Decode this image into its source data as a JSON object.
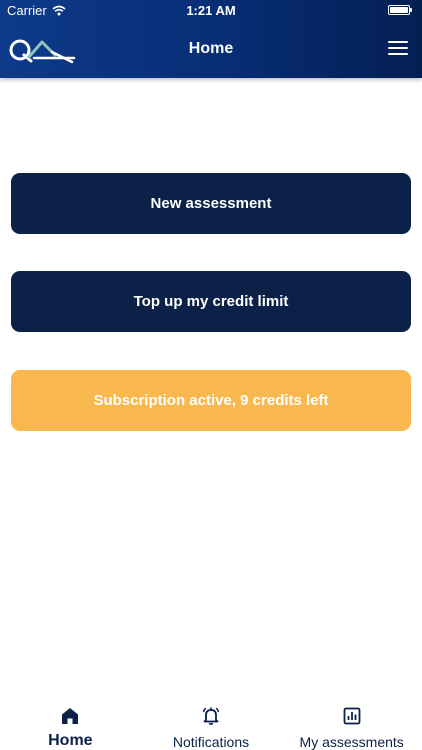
{
  "status_bar": {
    "carrier": "Carrier",
    "time": "1:21 AM"
  },
  "header": {
    "title": "Home",
    "logo": "QA-logo",
    "menu_icon": "hamburger-menu-icon"
  },
  "actions": {
    "new_assessment": "New assessment",
    "top_up": "Top up my credit limit",
    "subscription": "Subscription active, 9 credits left"
  },
  "tabs": [
    {
      "label": "Home",
      "icon": "home-icon",
      "active": true
    },
    {
      "label": "Notifications",
      "icon": "bell-icon",
      "active": false
    },
    {
      "label": "My assessments",
      "icon": "chart-icon",
      "active": false
    }
  ],
  "colors": {
    "header_start": "#0e3a8a",
    "header_end": "#041f52",
    "dark_button": "#0b2147",
    "subscription_button": "#f8b84e",
    "logo_accent": "#8fc4bf"
  }
}
